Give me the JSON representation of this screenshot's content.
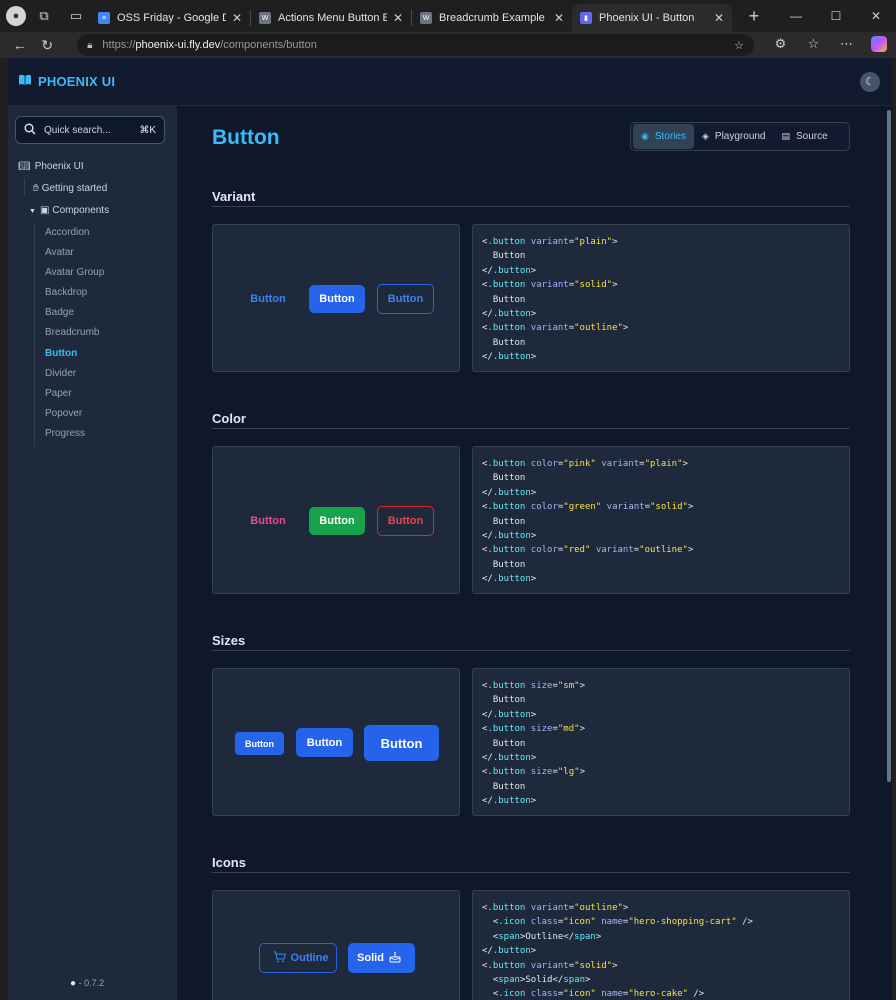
{
  "browser": {
    "tabs": [
      {
        "title": "OSS Friday - Google Docs",
        "favicon_color": "#4285f4",
        "active": false
      },
      {
        "title": "Actions Menu Button Example",
        "favicon_color": "#6b7280",
        "active": false
      },
      {
        "title": "Breadcrumb Example | APG | W",
        "favicon_color": "#6b7280",
        "active": false
      },
      {
        "title": "Phoenix UI - Button",
        "favicon_color": "#6366f1",
        "active": true
      }
    ],
    "url_scheme": "https://",
    "url_host": "phoenix-ui.fly.dev",
    "url_path": "/components/button"
  },
  "app": {
    "logo_text": "PHOENIX UI",
    "search_placeholder": "Quick search...",
    "search_shortcut": "⌘K",
    "nav_root": "Phoenix UI",
    "nav_getting_started": "Getting started",
    "nav_components": "Components",
    "components": [
      "Accordion",
      "Avatar",
      "Avatar Group",
      "Backdrop",
      "Badge",
      "Breadcrumb",
      "Button",
      "Divider",
      "Paper",
      "Popover",
      "Progress"
    ],
    "current_component": "Button",
    "version": "0.7.2"
  },
  "page": {
    "title": "Button",
    "view_tabs": [
      "Stories",
      "Playground",
      "Source"
    ],
    "active_view_tab": "Stories"
  },
  "sections": {
    "variant": {
      "title": "Variant",
      "buttons": {
        "plain": "Button",
        "solid": "Button",
        "outline": "Button"
      },
      "code": [
        "<.button variant=\"plain\">",
        "  Button",
        "</.button>",
        "<.button variant=\"solid\">",
        "  Button",
        "</.button>",
        "<.button variant=\"outline\">",
        "  Button",
        "</.button>"
      ]
    },
    "color": {
      "title": "Color",
      "buttons": {
        "pink": "Button",
        "green": "Button",
        "red": "Button"
      },
      "colors": {
        "pink": "#ec4899",
        "green": "#16a34a",
        "red": "#ef4444"
      },
      "code": [
        "<.button color=\"pink\" variant=\"plain\">",
        "  Button",
        "</.button>",
        "<.button color=\"green\" variant=\"solid\">",
        "  Button",
        "</.button>",
        "<.button color=\"red\" variant=\"outline\">",
        "  Button",
        "</.button>"
      ]
    },
    "sizes": {
      "title": "Sizes",
      "buttons": {
        "sm": "Button",
        "md": "Button",
        "lg": "Button"
      },
      "code": [
        "<.button size=\"sm\">",
        "  Button",
        "</.button>",
        "<.button size=\"md\">",
        "  Button",
        "</.button>",
        "<.button size=\"lg\">",
        "  Button",
        "</.button>"
      ]
    },
    "icons": {
      "title": "Icons",
      "buttons": {
        "outline": "Outline",
        "solid": "Solid"
      },
      "code": [
        "<.button variant=\"outline\">",
        "  <.icon class=\"icon\" name=\"hero-shopping-cart\" />",
        "  <span>Outline</span>",
        "</.button>",
        "<.button variant=\"solid\">",
        "  <span>Solid</span>",
        "  <.icon class=\"icon\" name=\"hero-cake\" />"
      ]
    }
  },
  "theme": {
    "accent": "#38bdf8",
    "primary": "#2563eb",
    "bg": "#0f172a",
    "panel": "#1e293b"
  }
}
